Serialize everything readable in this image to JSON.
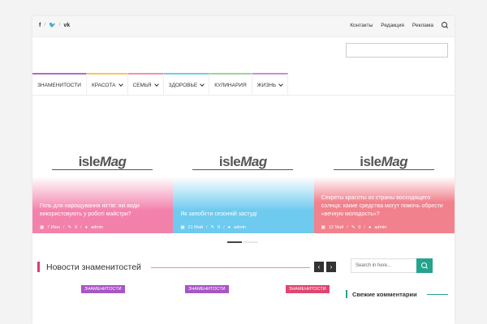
{
  "topbar": {
    "social": [
      {
        "icon": "facebook-icon",
        "glyph": "f"
      },
      {
        "icon": "twitter-icon",
        "glyph": "🐦"
      },
      {
        "icon": "vk-icon",
        "glyph": "vk"
      }
    ],
    "separator": "/",
    "links": [
      "Контакты",
      "Редакция",
      "Реклама"
    ]
  },
  "nav": {
    "items": [
      {
        "label": "ЗНАМЕНИТОСТИ",
        "color": "#b967c7",
        "dropdown": false
      },
      {
        "label": "КРАСОТА",
        "color": "#f7c65a",
        "dropdown": true
      },
      {
        "label": "СЕМЬЯ",
        "color": "#f291a6",
        "dropdown": true
      },
      {
        "label": "ЗДОРОВЬЕ",
        "color": "#6fcde8",
        "dropdown": true
      },
      {
        "label": "КУЛИНАРИЯ",
        "color": "#9fd39a",
        "dropdown": false
      },
      {
        "label": "ЖИЗНЬ",
        "color": "#c58fe0",
        "dropdown": true
      }
    ]
  },
  "slider": {
    "logo_text": "isle",
    "logo_italic": "Mag",
    "slides": [
      {
        "title": "Гель для нарощування нігтів: які види використовують у роботі майстри?",
        "date": "7 Июн",
        "comments": "0",
        "author": "admin",
        "color": "#f27aa6"
      },
      {
        "title": "Як запобігти сезонній застуді",
        "date": "21 Май",
        "comments": "0",
        "author": "admin",
        "color": "#66c7ee"
      },
      {
        "title": "Секреты красоты из страны восходящего солнца: какие средства могут помочь обрести «вечную молодость»?",
        "date": "12 Май",
        "comments": "0",
        "author": "admin",
        "color": "#f07a86"
      }
    ]
  },
  "news": {
    "title": "Новости знаменитостей",
    "prev": "‹",
    "next": "›",
    "tags": [
      {
        "label": "ЗНАМЕНИТОСТИ",
        "color": "#a855c5"
      },
      {
        "label": "ЗНАМЕНИТОСТИ",
        "color": "#a855c5"
      },
      {
        "label": "ЗНАМЕНИТОСТИ",
        "color": "#e0456f"
      }
    ]
  },
  "sidebar": {
    "search_placeholder": "Search in here...",
    "comments_title": "Свежие комментарии"
  }
}
